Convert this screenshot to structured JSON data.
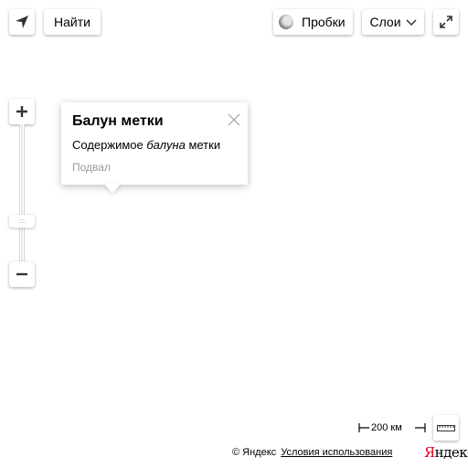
{
  "toolbar": {
    "find_label": "Найти",
    "traffic_label": "Пробки",
    "layers_label": "Слои",
    "icons": {
      "geolocation": "geolocation-arrow-icon",
      "traffic": "traffic-circle-icon",
      "layers_chevron": "chevron-down-icon",
      "fullscreen": "fullscreen-expand-icon"
    }
  },
  "zoom": {
    "plus_icon": "plus-icon",
    "minus_icon": "minus-icon",
    "thumb_glyph": "::::"
  },
  "balloon": {
    "title": "Балун метки",
    "body_prefix": "Содержимое ",
    "body_emphasis": "балуна",
    "body_suffix": " метки",
    "footer": "Подвал",
    "close_icon": "close-icon"
  },
  "scale": {
    "label": "200 км",
    "ruler_icon": "ruler-icon"
  },
  "copyrights": {
    "owner": "© Яндекс",
    "terms": "Условия использования",
    "logo_first": "Я",
    "logo_rest": "ндекс",
    "logo_color": "#e2001a"
  }
}
